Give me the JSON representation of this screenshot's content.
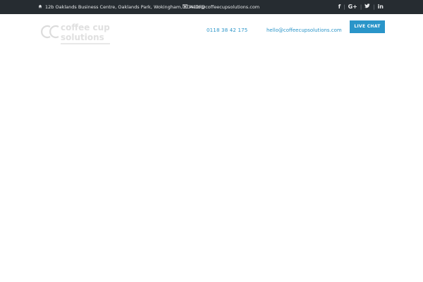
{
  "topbar": {
    "address": "12b Oaklands Business Centre, Oaklands Park, Wokingham, RG412FD",
    "email": "hello@coffeecupsolutions.com",
    "social": {
      "facebook": "f",
      "google_plus": "G+",
      "twitter": "t",
      "linkedin": "in"
    }
  },
  "header": {
    "logo_text": "Coffee Cup Solutions",
    "phone": "0118 38 42 175",
    "email": "hello@coffeecupsolutions.com",
    "chat_label": "LIVE CHAT"
  },
  "colors": {
    "topbar_bg": "#262c31",
    "accent": "#2a95c9"
  },
  "icons": [
    "home-icon",
    "envelope-icon",
    "facebook-icon",
    "google-plus-icon",
    "twitter-icon",
    "linkedin-icon"
  ]
}
